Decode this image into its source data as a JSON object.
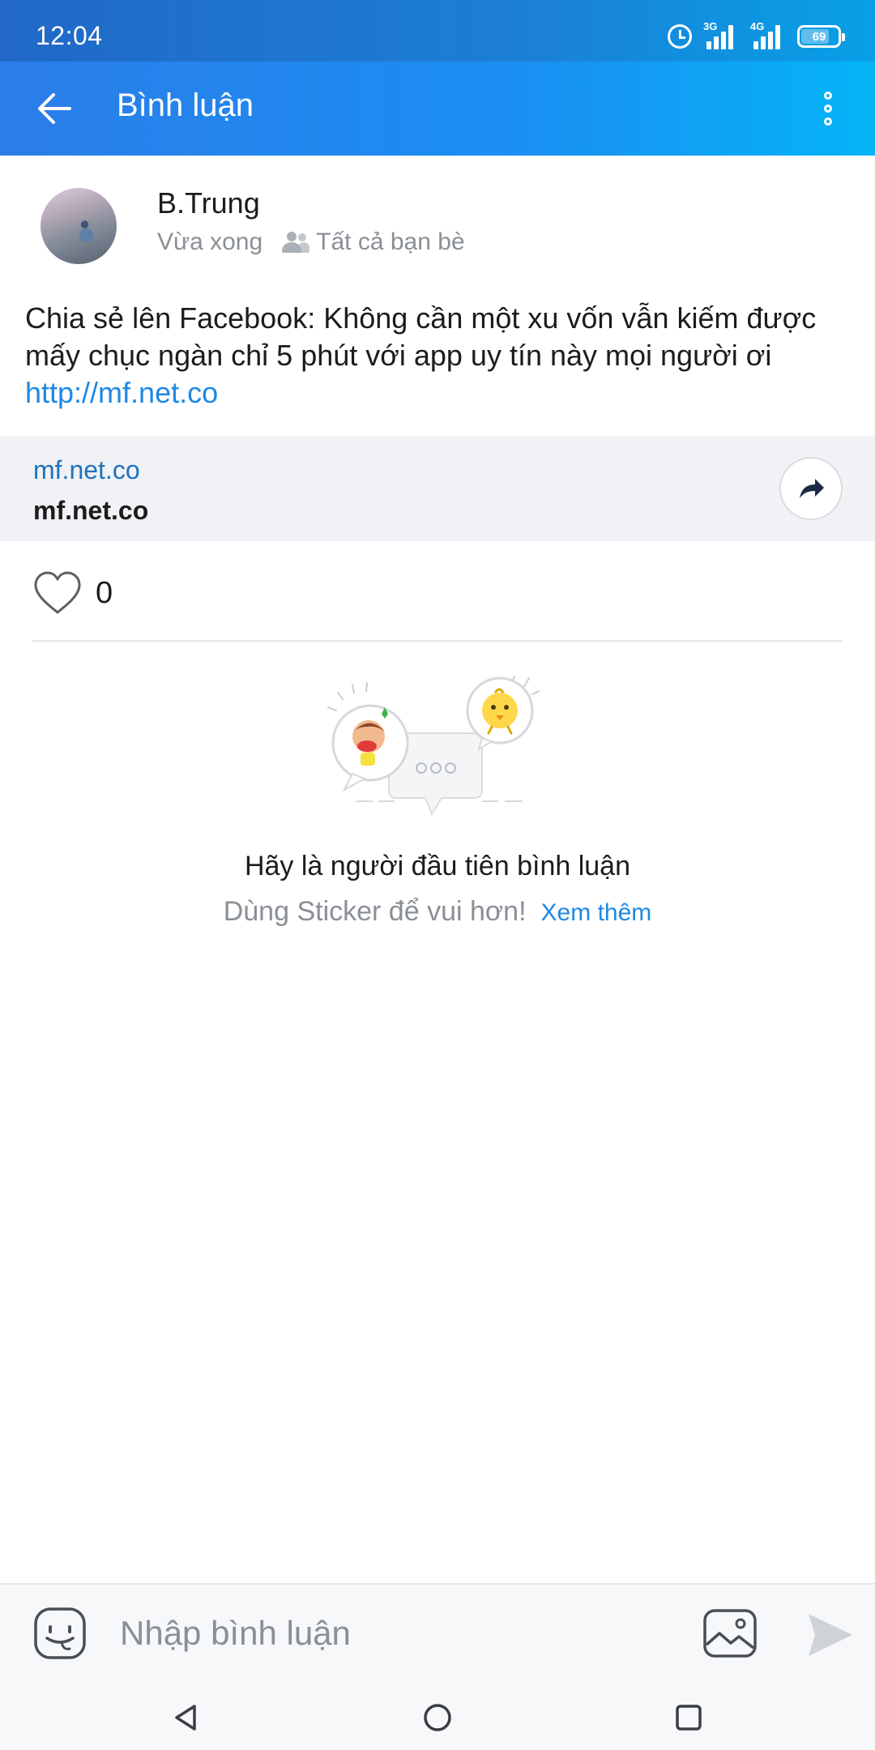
{
  "status_bar": {
    "time": "12:04",
    "signal_1_label": "3G",
    "signal_2_label": "4G",
    "battery": "69"
  },
  "app_bar": {
    "title": "Bình luận",
    "back_icon": "arrow-left-icon",
    "more_icon": "more-vertical-icon"
  },
  "post": {
    "author": "B.Trung",
    "time": "Vừa xong",
    "privacy": "Tất cả bạn bè",
    "text": "Chia sẻ lên Facebook: Không cần một xu vốn vẫn kiếm được mấy chục ngàn chỉ 5 phút với app uy tín này mọi người ơi",
    "link": "http://mf.net.co"
  },
  "link_card": {
    "domain": "mf.net.co",
    "title": "mf.net.co",
    "share_icon": "share-arrow-icon"
  },
  "likes": {
    "count": "0",
    "icon": "heart-outline-icon"
  },
  "empty_state": {
    "title": "Hãy là người đầu tiên bình luận",
    "subtitle": "Dùng Sticker để vui hơn!",
    "more_link": "Xem thêm"
  },
  "comment_bar": {
    "placeholder": "Nhập bình luận",
    "sticker_icon": "sticker-smile-icon",
    "image_icon": "image-icon",
    "send_icon": "send-icon"
  },
  "colors": {
    "accent": "#1e88e5",
    "appbar_start": "#2b7de9",
    "appbar_end": "#04b4f6",
    "muted_text": "#8a8f96",
    "card_bg": "#f0f2f5"
  }
}
